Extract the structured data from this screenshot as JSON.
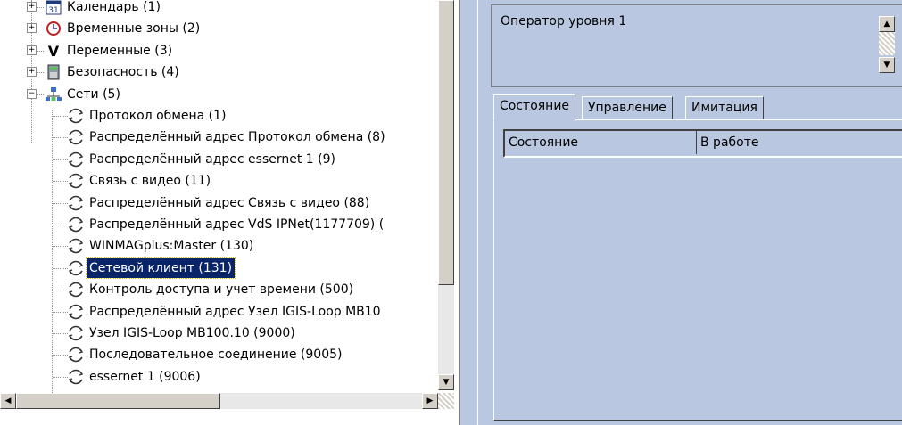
{
  "tree": {
    "items": [
      {
        "label": "Календарь (1)",
        "icon": "calendar-icon",
        "level": 1,
        "expander": "+"
      },
      {
        "label": "Временные зоны (2)",
        "icon": "clock-icon",
        "level": 1,
        "expander": "+"
      },
      {
        "label": "Переменные (3)",
        "icon": "variable-icon",
        "level": 1,
        "expander": "+"
      },
      {
        "label": "Безопасность (4)",
        "icon": "security-icon",
        "level": 1,
        "expander": "+"
      },
      {
        "label": "Сети (5)",
        "icon": "network-icon",
        "level": 1,
        "expander": "−"
      },
      {
        "label": "Протокол обмена (1)",
        "icon": "protocol-icon",
        "level": 2
      },
      {
        "label": "Распределённый адрес Протокол обмена (8)",
        "icon": "protocol-icon",
        "level": 2
      },
      {
        "label": "Распределённый адрес essernet 1 (9)",
        "icon": "protocol-icon",
        "level": 2
      },
      {
        "label": "Связь с видео (11)",
        "icon": "protocol-icon",
        "level": 2
      },
      {
        "label": "Распределённый адрес Связь с видео (88)",
        "icon": "protocol-icon",
        "level": 2
      },
      {
        "label": "Распределённый адрес VdS IPNet(1177709) (",
        "icon": "protocol-icon",
        "level": 2
      },
      {
        "label": "WINMAGplus:Master (130)",
        "icon": "protocol-icon",
        "level": 2
      },
      {
        "label": "Сетевой клиент (131)",
        "icon": "protocol-icon",
        "level": 2,
        "selected": true
      },
      {
        "label": "Контроль доступа и учет времени (500)",
        "icon": "protocol-icon",
        "level": 2
      },
      {
        "label": "Распределённый адрес Узел IGIS-Loop MB10",
        "icon": "protocol-icon",
        "level": 2
      },
      {
        "label": "Узел IGIS-Loop MB100.10 (9000)",
        "icon": "protocol-icon",
        "level": 2
      },
      {
        "label": "Последовательное соединение (9005)",
        "icon": "protocol-icon",
        "level": 2
      },
      {
        "label": "essernet 1 (9006)",
        "icon": "protocol-icon",
        "level": 2
      }
    ]
  },
  "operator": {
    "name": "Оператор уровня 1"
  },
  "tabs": [
    {
      "label": "Состояние",
      "active": true
    },
    {
      "label": "Управление",
      "active": false
    },
    {
      "label": "Имитация",
      "active": false
    }
  ],
  "state_grid": {
    "name": "Состояние",
    "value": "В работе"
  },
  "colors": {
    "panel_bg": "#b9c8e0",
    "selection_bg": "#0a246a"
  }
}
